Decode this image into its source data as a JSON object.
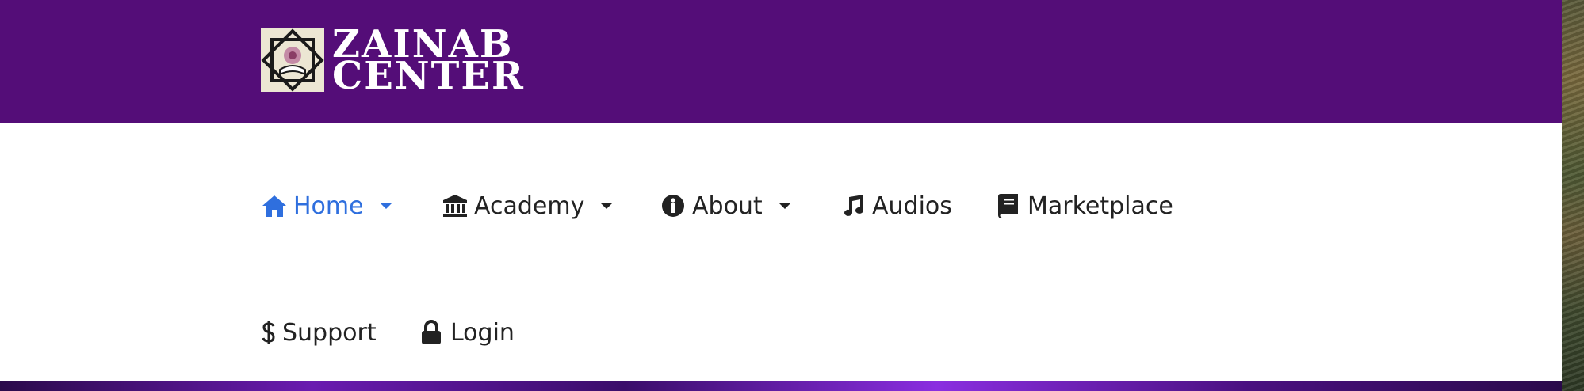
{
  "brand": {
    "line1": "ZAINAB",
    "line2": "CENTER",
    "header_color": "#540d78",
    "emblem_icon": "star-emblem-icon"
  },
  "nav": {
    "active_color": "#2f6fde",
    "text_color": "#222222",
    "items": [
      {
        "label": "Home",
        "icon": "home-icon",
        "has_dropdown": true,
        "active": true
      },
      {
        "label": "Academy",
        "icon": "institution-icon",
        "has_dropdown": true,
        "active": false
      },
      {
        "label": "About",
        "icon": "info-circle-icon",
        "has_dropdown": true,
        "active": false
      },
      {
        "label": "Audios",
        "icon": "music-icon",
        "has_dropdown": false,
        "active": false
      },
      {
        "label": "Marketplace",
        "icon": "book-icon",
        "has_dropdown": false,
        "active": false
      },
      {
        "label": "Support",
        "icon": "dollar-icon",
        "has_dropdown": false,
        "active": false
      },
      {
        "label": "Login",
        "icon": "lock-icon",
        "has_dropdown": false,
        "active": false
      }
    ]
  }
}
